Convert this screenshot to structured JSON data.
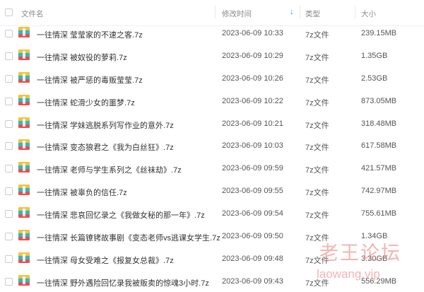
{
  "header": {
    "name_label": "文件名",
    "time_label": "修改时间",
    "type_label": "类型",
    "size_label": "大小"
  },
  "files": [
    {
      "name": "一往情深 莹莹家的不速之客.7z",
      "time": "2023-06-09 10:33",
      "type": "7z文件",
      "size": "239.15MB"
    },
    {
      "name": "一往情深 被奴役的萝莉.7z",
      "time": "2023-06-09 10:29",
      "type": "7z文件",
      "size": "1.35GB"
    },
    {
      "name": "一往情深 被严惩的毒贩莹莹.7z",
      "time": "2023-06-09 10:26",
      "type": "7z文件",
      "size": "2.53GB"
    },
    {
      "name": "一往情深 蛇滑少女的噩梦.7z",
      "time": "2023-06-09 10:22",
      "type": "7z文件",
      "size": "873.05MB"
    },
    {
      "name": "一往情深 学妹逃脱系列写作业的意外.7z",
      "time": "2023-06-09 10:21",
      "type": "7z文件",
      "size": "318.48MB"
    },
    {
      "name": "一往情深 变态狼君之《我为白丝狂》.7z",
      "time": "2023-06-09 10:03",
      "type": "7z文件",
      "size": "617.58MB"
    },
    {
      "name": "一往情深 老师与学生系列之《丝袜劫》.7z",
      "time": "2023-06-09 09:59",
      "type": "7z文件",
      "size": "421.57MB"
    },
    {
      "name": "一往情深 被辜负的信任.7z",
      "time": "2023-06-09 09:55",
      "type": "7z文件",
      "size": "742.97MB"
    },
    {
      "name": "一往情深 悲哀回忆录之《我做女秘的那一年》.7z",
      "time": "2023-06-09 09:54",
      "type": "7z文件",
      "size": "755.61MB"
    },
    {
      "name": "一往情深 长篇镣铐故事剧《变态老师vs逃课女学生.7z",
      "time": "2023-06-09 09:50",
      "type": "7z文件",
      "size": "1.34GB"
    },
    {
      "name": "一往情深 母女受难之《报复女总裁》.7z",
      "time": "2023-06-09 09:48",
      "type": "7z文件",
      "size": "3.30GB"
    },
    {
      "name": "一往情深 野外遇险回忆录我被贩卖的惊魂3小时.7z",
      "time": "2023-06-09 09:43",
      "type": "7z文件",
      "size": "556.29MB"
    }
  ],
  "watermark": {
    "title": "老王论坛",
    "url": "laowang.vip"
  },
  "colors": {
    "accent": "#2f8bf5",
    "watermark": "#ef8c8c",
    "icon_teal": "#2fb9c4",
    "icon_yellow": "#f6c23b",
    "icon_red": "#f04c4c"
  },
  "icons": {
    "file_icon": "archive-7z-icon",
    "sort": "arrow-down-icon"
  }
}
